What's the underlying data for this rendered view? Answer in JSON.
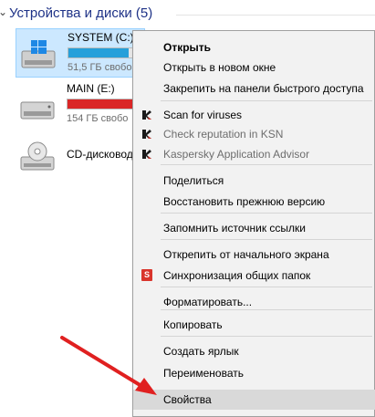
{
  "explorer": {
    "group_title": "Устройства и диски (5)",
    "drives": [
      {
        "name": "SYSTEM (C:)",
        "free": "51,5 ГБ свобо",
        "icon": "windows-drive-icon",
        "usage": 0.55,
        "bar_color": "#26a0da"
      },
      {
        "name": "MAIN (E:)",
        "free": "154 ГБ свобо",
        "icon": "hard-drive-icon",
        "usage": 0.95,
        "bar_color": "#da2626"
      },
      {
        "name": "CD-дисковод",
        "icon": "cd-drive-icon"
      }
    ]
  },
  "context_menu": {
    "items": [
      {
        "label": "Открыть",
        "bold": true
      },
      {
        "label": "Открыть в новом окне"
      },
      {
        "label": "Закрепить на панели быстрого доступа"
      },
      {
        "label": "Scan for viruses",
        "icon": "kaspersky-icon"
      },
      {
        "label": "Check reputation in KSN",
        "icon": "kaspersky-icon",
        "disabled": true
      },
      {
        "label": "Kaspersky Application Advisor",
        "icon": "kaspersky-icon",
        "disabled": true
      },
      {
        "label": "Поделиться"
      },
      {
        "label": "Восстановить прежнюю версию"
      },
      {
        "label": "Запомнить источник ссылки"
      },
      {
        "label": "Открепить от начального экрана"
      },
      {
        "label": "Синхронизация общих папок",
        "icon": "sync-icon",
        "icon_text": "S"
      },
      {
        "label": "Форматировать..."
      },
      {
        "label": "Копировать"
      },
      {
        "label": "Создать ярлык"
      },
      {
        "label": "Переименовать"
      },
      {
        "label": "Свойства",
        "highlighted": true
      }
    ]
  },
  "colors": {
    "arrow": "#e02020",
    "selection": "#cce8ff",
    "menu_bg": "#f2f2f2"
  }
}
